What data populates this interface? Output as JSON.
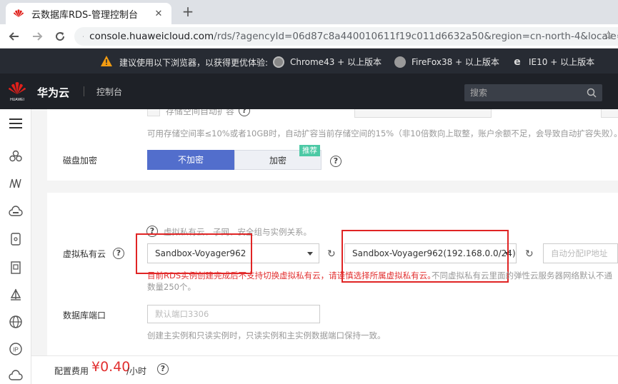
{
  "browser": {
    "tab_title": "云数据库RDS-管理控制台",
    "tab_close": "✕",
    "new_tab": "+",
    "url_host": "console.huaweicloud.com",
    "url_path": "/rds/?agencyId=06d87c8a440010611f19c011d6632a50&region=cn-north-4&locale=z···"
  },
  "warning_bar": {
    "text": "建议使用以下浏览器，以获得更优体验:",
    "browsers": [
      "Chrome43 + 以上版本",
      "FireFox38 + 以上版本",
      "IE10 + 以上版本"
    ]
  },
  "header": {
    "brand": "华为云",
    "logo_text": "HUAWEI",
    "console": "控制台",
    "search_placeholder": "搜索"
  },
  "storage": {
    "partial_row": "存储空间自动扩容",
    "hint": "可用存储空间率≤10%或者10GB时，自动扩容当前存储空间的15%（非10倍数向上取整，账户余额不足，会导致自动扩容失败）。"
  },
  "encryption": {
    "label": "磁盘加密",
    "options": [
      "不加密",
      "加密"
    ],
    "selected": "不加密",
    "badge": "推荐"
  },
  "vpc": {
    "hint": "虚拟私有云、子网、安全组与实例关系。",
    "label": "虚拟私有云",
    "vpc_value": "Sandbox-Voyager962",
    "subnet_value": "Sandbox-Voyager962(192.168.0.0/24)",
    "ip_placeholder": "自动分配IP地址",
    "warning_red": "目前RDS实例创建完成后不支持切换虚拟私有云，请谨慎选择所属虚拟私有云。",
    "warning_gray": "不同虚拟私有云里面的弹性云服务器网络默认不通",
    "warning_line2": "数量250个。"
  },
  "port": {
    "label": "数据库端口",
    "placeholder": "默认端口3306",
    "hint": "创建主实例和只读实例时，只读实例和主实例数据端口保持一致。"
  },
  "footer": {
    "fee_label": "配置费用",
    "price": "¥0.40",
    "unit": "/小时"
  }
}
